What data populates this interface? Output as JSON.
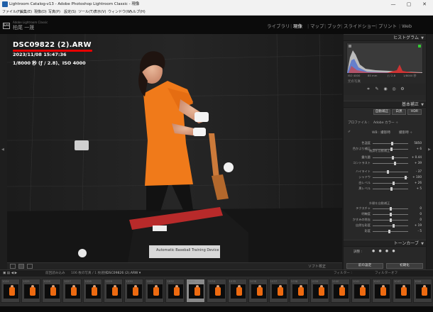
{
  "window": {
    "title": "Lightroom Catalog-v13 - Adobe Photoshop Lightroom Classic - 現像",
    "controls": [
      "—",
      "▢",
      "✕"
    ]
  },
  "menubar": {
    "items": [
      "ファイル(F)",
      "編集(E)",
      "現像(D)",
      "写真(P)",
      "設定(S)",
      "ツール(T)",
      "表示(V)",
      "ウィンドウ(W)",
      "ヘルプ(H)"
    ]
  },
  "identity": {
    "logo": "Lrc",
    "subtitle": "Adobe Lightroom Classic",
    "name": "柏尾 一晟"
  },
  "modules": [
    {
      "label": "ライブラリ",
      "active": false
    },
    {
      "label": "現像",
      "active": true
    },
    {
      "label": "マップ",
      "active": false
    },
    {
      "label": "ブック",
      "active": false
    },
    {
      "label": "スライドショー",
      "active": false
    },
    {
      "label": "プリント",
      "active": false
    },
    {
      "label": "Web",
      "active": false
    }
  ],
  "overlay": {
    "filename": "DSC09822 (2).ARW",
    "datetime": "2023/11/08 15:47:36",
    "exposure": "1/8000 秒 (ƒ / 2.8)、ISO 4000",
    "underline_color": "#e60000"
  },
  "photo": {
    "sign_text": "Automatic Baseball Training Device"
  },
  "histogram": {
    "title": "ヒストグラム",
    "iso": "ISO 4000",
    "focal": "85 mm",
    "aperture": "ƒ / 2.8",
    "shutter": "1/8000 秒",
    "original": "元の写真"
  },
  "basic": {
    "title": "基本補正",
    "buttons": [
      "自動補正",
      "白黒",
      "HDR"
    ],
    "profile_label": "プロファイル :",
    "profile_value": "Adobe カラー ÷",
    "wb_label": "WB : 撮影時",
    "wb_value": "撮影時 ÷",
    "groups": [
      "階調を自動補正",
      "外観を自動補正"
    ],
    "sliders": [
      {
        "label": "色温度",
        "value": "5850",
        "pos": 0.55
      },
      {
        "label": "色かぶり補正",
        "value": "+ 6",
        "pos": 0.52
      },
      {
        "label": "露光量",
        "value": "+ 0.44",
        "pos": 0.56
      },
      {
        "label": "コントラスト",
        "value": "+ 39",
        "pos": 0.62
      },
      {
        "label": "ハイライト",
        "value": "- 37",
        "pos": 0.42
      },
      {
        "label": "シャドウ",
        "value": "+ 100",
        "pos": 0.92
      },
      {
        "label": "白レベル",
        "value": "+ 26",
        "pos": 0.58
      },
      {
        "label": "黒レベル",
        "value": "+ 5",
        "pos": 0.52
      },
      {
        "label": "テクスチャ",
        "value": "0",
        "pos": 0.5
      },
      {
        "label": "明瞭度",
        "value": "0",
        "pos": 0.5
      },
      {
        "label": "かすみの除去",
        "value": "0",
        "pos": 0.5
      },
      {
        "label": "自然な彩度",
        "value": "+ 19",
        "pos": 0.58
      },
      {
        "label": "彩度",
        "value": "- 5",
        "pos": 0.47
      }
    ]
  },
  "tonecurve": {
    "title": "トーンカーブ",
    "mode": "調整 :"
  },
  "panel_buttons": {
    "previous": "前の設定",
    "reset": "初期化"
  },
  "toolbar": {
    "softproof": "ソフト校正"
  },
  "filmstrip_nav": {
    "path": "前回読み込み",
    "info": "106 枚の写真 / 1 枚選択",
    "current": "DSC09826 (2).ARW ▾",
    "filter_label": "フィルター :",
    "filter_value": "フィルターオフ"
  },
  "filmstrip": {
    "numbers": [
      "1024",
      "1025",
      "1026",
      "1027",
      "1028",
      "1029",
      "1030",
      "1031",
      "1032",
      "1033",
      "1034",
      "1035",
      "1036",
      "1037",
      "1038",
      "1039",
      "1040",
      "1041",
      "1042",
      "1043",
      "1044"
    ],
    "selected_index": 9
  }
}
